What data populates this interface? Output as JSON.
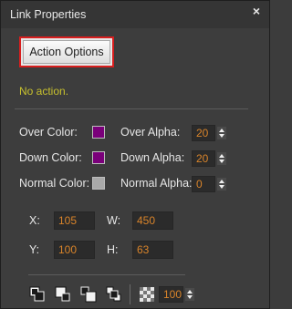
{
  "panel": {
    "title": "Link Properties",
    "close_icon": "close-x-icon"
  },
  "action": {
    "button_label": "Action Options",
    "status": "No action."
  },
  "colors": {
    "over_label": "Over Color:",
    "over_color": "#7a007a",
    "down_label": "Down Color:",
    "down_color": "#7a007a",
    "normal_label": "Normal Color:",
    "normal_color": "#a9a9a9",
    "over_alpha_label": "Over Alpha:",
    "over_alpha": "20",
    "down_alpha_label": "Down Alpha:",
    "down_alpha": "20",
    "normal_alpha_label": "Normal Alpha:",
    "normal_alpha": "0"
  },
  "geometry": {
    "x_label": "X:",
    "x_value": "105",
    "w_label": "W:",
    "w_value": "450",
    "y_label": "Y:",
    "y_value": "100",
    "h_label": "H:",
    "h_value": "63"
  },
  "toolbar": {
    "icons": [
      "bring-to-front-icon",
      "bring-forward-icon",
      "send-backward-icon",
      "send-to-back-icon",
      "transparency-icon"
    ],
    "opacity_value": "100"
  }
}
